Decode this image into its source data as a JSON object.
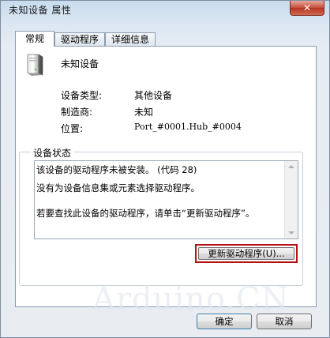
{
  "window": {
    "title": "未知设备 属性",
    "close_label": "✕"
  },
  "tabs": [
    {
      "label": "常规"
    },
    {
      "label": "驱动程序"
    },
    {
      "label": "详细信息"
    }
  ],
  "device": {
    "name": "未知设备",
    "props": [
      {
        "label": "设备类型:",
        "value": "其他设备"
      },
      {
        "label": "制造商:",
        "value": "未知"
      },
      {
        "label": "位置:",
        "value": "Port_#0001.Hub_#0004"
      }
    ]
  },
  "status": {
    "group_title": "设备状态",
    "lines": [
      "该设备的驱动程序未被安装。 (代码 28)",
      "没有为设备信息集或元素选择驱动程序。",
      "若要查找此设备的驱动程序，请单击“更新驱动程序”。"
    ],
    "update_button": "更新驱动程序(U)..."
  },
  "buttons": {
    "ok": "确定",
    "cancel": "取消"
  },
  "watermark": "Arduino.CN",
  "colors": {
    "highlight_border": "#b41212",
    "window_tint": "#dce7f2"
  }
}
